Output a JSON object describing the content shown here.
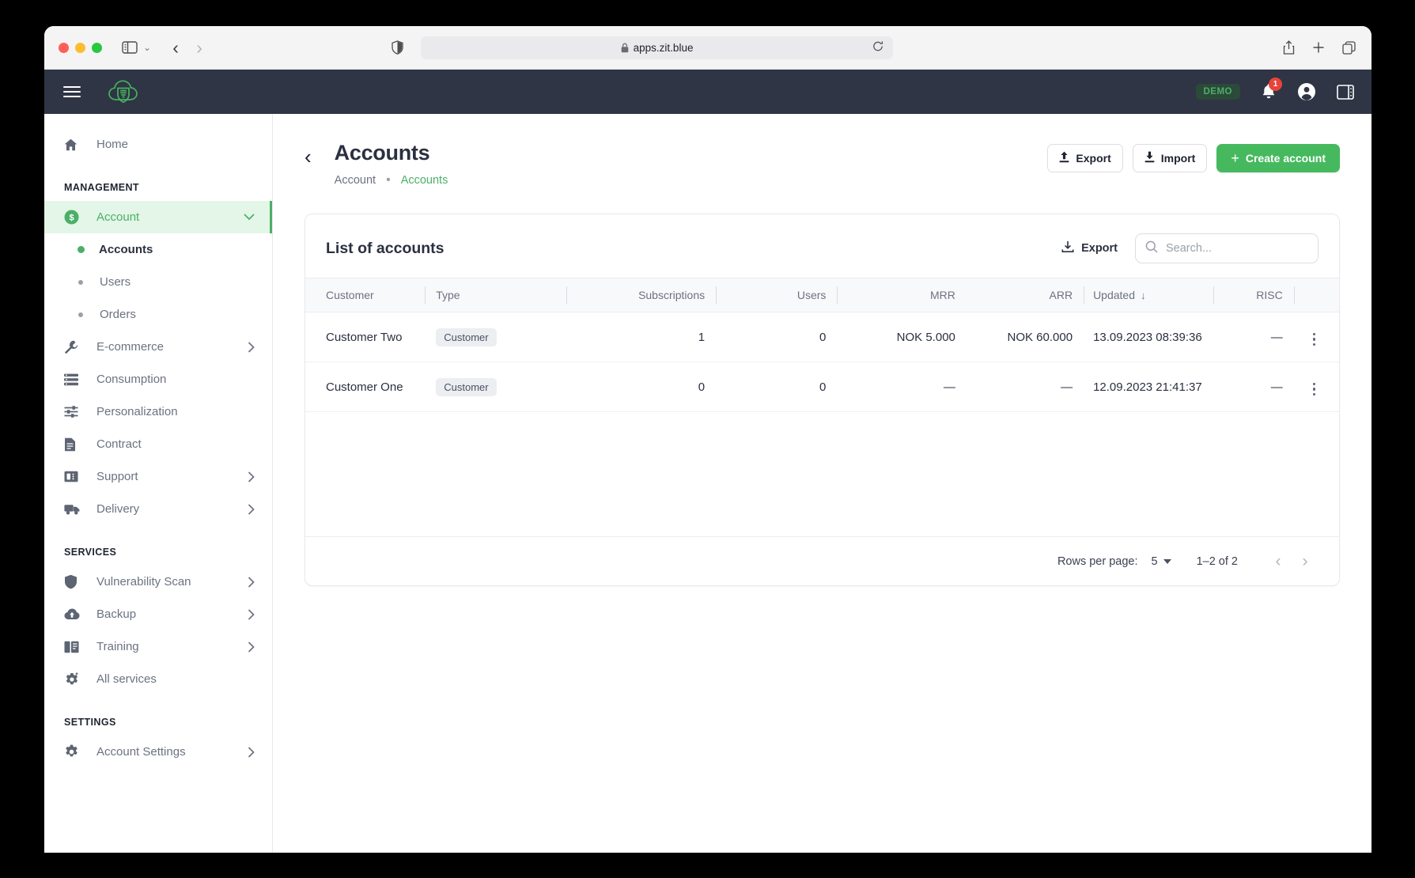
{
  "browser": {
    "url": "apps.zit.blue",
    "lock_icon": "lock-icon",
    "reload_icon": "reload-icon",
    "shield_icon": "shield-icon",
    "back_icon": "back-chevron-icon",
    "forward_icon": "forward-chevron-icon",
    "sidebar_icon": "sidebar-toggle-icon",
    "share_icon": "share-icon",
    "newtab_icon": "plus-icon",
    "tabs_icon": "tabs-overview-icon"
  },
  "app_header": {
    "menu_icon": "hamburger-menu-icon",
    "logo_icon": "cloud-shield-logo-icon",
    "demo_badge": "DEMO",
    "notification_count": "1",
    "bell_icon": "bell-icon",
    "account_icon": "account-circle-icon",
    "panel_icon": "right-panel-icon"
  },
  "sidebar": {
    "home": {
      "label": "Home",
      "icon": "home-icon"
    },
    "sections": [
      {
        "title": "MANAGEMENT",
        "items": [
          {
            "label": "Account",
            "icon": "dollar-circle-icon",
            "caret": "chevron-down-icon",
            "active": true
          },
          {
            "label": "E-commerce",
            "icon": "wrench-icon",
            "caret": "chevron-right-icon"
          },
          {
            "label": "Consumption",
            "icon": "list-icon",
            "caret": ""
          },
          {
            "label": "Personalization",
            "icon": "sliders-icon",
            "caret": ""
          },
          {
            "label": "Contract",
            "icon": "document-icon",
            "caret": ""
          },
          {
            "label": "Support",
            "icon": "ticket-icon",
            "caret": "chevron-right-icon"
          },
          {
            "label": "Delivery",
            "icon": "truck-icon",
            "caret": "chevron-right-icon"
          }
        ],
        "sub_items": [
          {
            "label": "Accounts",
            "current": true
          },
          {
            "label": "Users",
            "current": false
          },
          {
            "label": "Orders",
            "current": false
          }
        ]
      },
      {
        "title": "SERVICES",
        "items": [
          {
            "label": "Vulnerability Scan",
            "icon": "shield-icon",
            "caret": "chevron-right-icon"
          },
          {
            "label": "Backup",
            "icon": "cloud-upload-icon",
            "caret": "chevron-right-icon"
          },
          {
            "label": "Training",
            "icon": "book-icon",
            "caret": "chevron-right-icon"
          },
          {
            "label": "All services",
            "icon": "gear-plus-icon",
            "caret": ""
          }
        ]
      },
      {
        "title": "SETTINGS",
        "items": [
          {
            "label": "Account Settings",
            "icon": "gear-icon",
            "caret": "chevron-right-icon"
          }
        ]
      }
    ]
  },
  "page": {
    "back_icon": "back-chevron-icon",
    "title": "Accounts",
    "breadcrumb": {
      "parent": "Account",
      "separator": "•",
      "current": "Accounts"
    },
    "actions": {
      "export": {
        "label": "Export",
        "icon": "upload-icon"
      },
      "import": {
        "label": "Import",
        "icon": "download-icon"
      },
      "create": {
        "label": "Create account",
        "icon": "plus-icon"
      }
    }
  },
  "card": {
    "title": "List of accounts",
    "export": {
      "label": "Export",
      "icon": "download-tray-icon"
    },
    "search": {
      "placeholder": "Search...",
      "value": "",
      "icon": "search-icon"
    },
    "table": {
      "columns": [
        {
          "label": "Customer",
          "align": "left"
        },
        {
          "label": "Type",
          "align": "left"
        },
        {
          "label": "Subscriptions",
          "align": "right"
        },
        {
          "label": "Users",
          "align": "right"
        },
        {
          "label": "MRR",
          "align": "right"
        },
        {
          "label": "ARR",
          "align": "right"
        },
        {
          "label": "Updated",
          "align": "left",
          "sort": "↓"
        },
        {
          "label": "RISC",
          "align": "right"
        },
        {
          "label": "",
          "align": "right"
        }
      ],
      "rows": [
        {
          "customer": "Customer Two",
          "type": "Customer",
          "subscriptions": "1",
          "users": "0",
          "mrr": "NOK 5.000",
          "arr": "NOK 60.000",
          "updated": "13.09.2023 08:39:36",
          "risc": "—",
          "menu_icon": "kebab-menu-icon"
        },
        {
          "customer": "Customer One",
          "type": "Customer",
          "subscriptions": "0",
          "users": "0",
          "mrr": "—",
          "arr": "—",
          "updated": "12.09.2023 21:41:37",
          "risc": "—",
          "menu_icon": "kebab-menu-icon"
        }
      ]
    },
    "pagination": {
      "rows_per_page_label": "Rows per page:",
      "rows_per_page_value": "5",
      "range": "1–2 of 2",
      "prev_icon": "chevron-left-icon",
      "next_icon": "chevron-right-icon"
    }
  },
  "colors": {
    "accent_green": "#4caf68",
    "primary_button": "#46b95f",
    "header_dark": "#2f3545",
    "badge_red": "#e8443a"
  }
}
